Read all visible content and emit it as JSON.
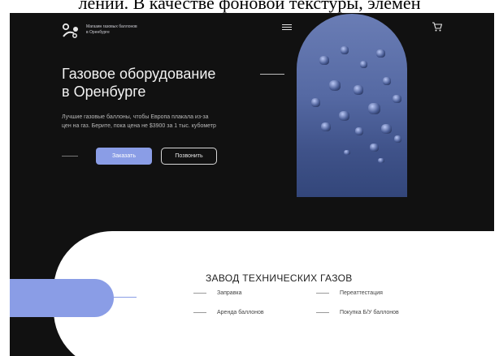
{
  "caption": "лений. В качестве фоновой текстуры, элемен",
  "header": {
    "logo_line1": "Магазин газовых баллонов",
    "logo_line2": "в Оренбурге"
  },
  "hero": {
    "title_line1": "Газовое оборудование",
    "title_line2": "в Оренбурге",
    "subtitle_line1": "Лучшие газовые баллоны, чтобы Европа плакала из-за",
    "subtitle_line2": "цен на газ. Берите, пока цена не  $3900 за 1 тыс. кубометр",
    "order_label": "Заказать",
    "call_label": "Позвонить"
  },
  "section": {
    "title": "ЗАВОД ТЕХНИЧЕСКИХ ГАЗОВ",
    "services": [
      {
        "label": "Заправка"
      },
      {
        "label": "Переаттестация"
      },
      {
        "label": "Аренда баллонов"
      },
      {
        "label": "Покупка Б/У баллонов"
      }
    ]
  },
  "colors": {
    "accent": "#8a9de6",
    "background": "#111111"
  },
  "icons": {
    "menu": "hamburger-menu-icon",
    "cart": "shopping-cart-icon",
    "logo": "gas-cylinder-logo-icon"
  }
}
